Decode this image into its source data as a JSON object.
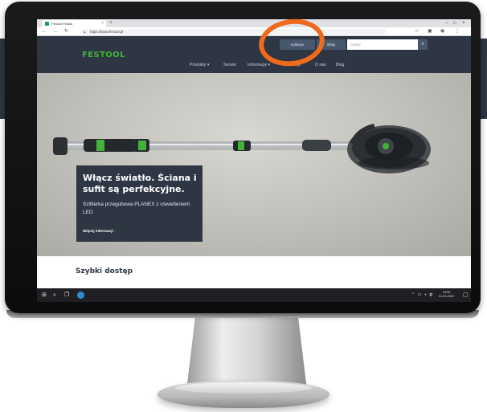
{
  "browser": {
    "tab_title": "Festool Polska",
    "url": "https://www.festool.pl",
    "new_tab": "+",
    "icons": {
      "back": "arrow-left-icon",
      "forward": "arrow-right-icon",
      "reload": "reload-icon",
      "lock": "lock-icon",
      "menu": "menu-icon"
    }
  },
  "site": {
    "logo": "FESTOOL",
    "header_buttons": [
      "Aplikacje",
      "Sklep"
    ],
    "search_placeholder": "Szukaj",
    "nav": [
      "Produkty ▾",
      "Serwis",
      "Informacje ▾",
      "Akcje",
      "O nas",
      "Blog"
    ]
  },
  "hero": {
    "title": "Włącz światło. Ściana i sufit są perfekcyjne.",
    "subtitle": "Szlifierka przegubowa PLANEX z oświetleniem LED",
    "link_label": "Więcej informacji",
    "link_arrow": "›"
  },
  "quick_access": {
    "title": "Szybki dostęp"
  },
  "taskbar": {
    "time": "10:00",
    "date": "01.01.2021",
    "icons": [
      "windows-icon",
      "search-icon",
      "task-view-icon",
      "edge-icon"
    ]
  },
  "colors": {
    "brand_green": "#42b338",
    "header_bg": "#2e3644",
    "annotation": "#f06a1c"
  }
}
